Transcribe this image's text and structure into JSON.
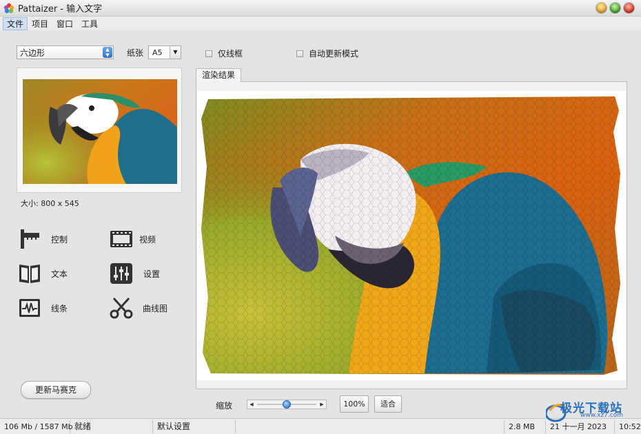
{
  "window": {
    "title": "Pattaizer - 输入文字",
    "buttons": [
      "minimize",
      "maximize",
      "close"
    ]
  },
  "menu": [
    {
      "label": "文件",
      "active": true
    },
    {
      "label": "项目",
      "active": false
    },
    {
      "label": "窗口",
      "active": false
    },
    {
      "label": "工具",
      "active": false
    }
  ],
  "toolbar": {
    "shape_value": "六边形",
    "paper_label": "纸张",
    "paper_value": "A5",
    "frame_only_label": "仅线框",
    "auto_update_label": "自动更新模式"
  },
  "preview": {
    "size_label": "大小: 800 x 545"
  },
  "tools": [
    {
      "id": "control",
      "label": "控制",
      "icon": "ruler-icon"
    },
    {
      "id": "video",
      "label": "视频",
      "icon": "film-icon"
    },
    {
      "id": "text",
      "label": "文本",
      "icon": "book-icon"
    },
    {
      "id": "settings",
      "label": "设置",
      "icon": "sliders-icon"
    },
    {
      "id": "lines",
      "label": "线条",
      "icon": "waveform-icon"
    },
    {
      "id": "curves",
      "label": "曲线图",
      "icon": "scissors-icon"
    }
  ],
  "update_button": "更新马赛克",
  "render": {
    "tab_label": "渲染结果"
  },
  "zoom": {
    "label": "缩放",
    "level": 0.5,
    "btn_100": "100%",
    "btn_fit": "适合"
  },
  "status": {
    "memory": "106 Mb / 1587 Mb",
    "state": "就绪",
    "preset": "默认设置",
    "file_size": "2.8 MB",
    "date": "21 十一月 2023",
    "time": "10:52"
  },
  "watermark": {
    "name": "极光下载站",
    "url": "www.xz7.com"
  }
}
